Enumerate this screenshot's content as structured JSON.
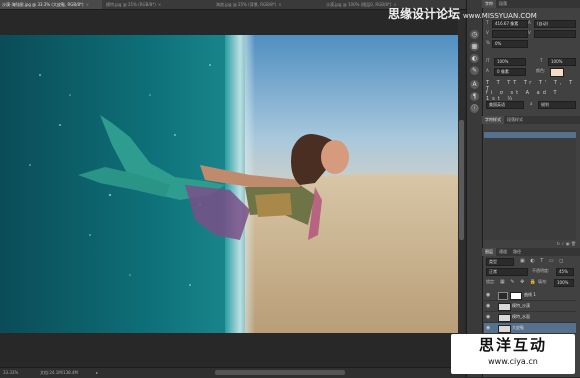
{
  "tabs": [
    {
      "label": "沙漠-海陆图.jpg @ 33.3% (大皮鞋, RGB/8*)",
      "active": true
    },
    {
      "label": "模特.jpg @ 25% (RGB/8*)",
      "active": false
    },
    {
      "label": "海浪.jpg @ 25% (背景, RGB/8*)",
      "active": false
    },
    {
      "label": "沙漠.jpg @ 100% (图层0, RGB/8*)",
      "active": false
    }
  ],
  "watermark_top": {
    "title": "思缘设计论坛",
    "site": "www.MISSYUAN.COM"
  },
  "watermark_bottom": {
    "title": "思洋互动",
    "url": "www.ciya.cn"
  },
  "status": {
    "zoom": "33.33%",
    "doc": "文档:24.1M/138.4M"
  },
  "character_panel": {
    "tabs": [
      "字符",
      "段落"
    ],
    "font_size": "416.67 像素",
    "leading": "(自动)",
    "tracking": "0%",
    "scale_v": "100%",
    "scale_h": "100%",
    "baseline": "0 像素",
    "color_label": "颜色:",
    "aa_label": "a",
    "aa_value": "锐利",
    "lang": "美国英语"
  },
  "paragraph_panel": {
    "tabs": [
      "字符样式",
      "段落样式"
    ]
  },
  "layers_panel": {
    "tabs": [
      "图层",
      "通道",
      "路径"
    ],
    "filter": "类型",
    "blend_mode": "正常",
    "opacity_label": "不透明度:",
    "opacity": "45%",
    "lock_label": "锁定:",
    "fill_label": "填充:",
    "fill": "100%",
    "layers": [
      {
        "name": "曲线 1",
        "selected": false
      },
      {
        "name": "模特_沙漠",
        "selected": false
      },
      {
        "name": "模特_水面",
        "selected": false
      },
      {
        "name": "大皮鞋",
        "selected": true
      }
    ]
  },
  "icons": [
    "close-icon",
    "eye-icon",
    "lock-icon",
    "search-icon",
    "adjustment-icon"
  ]
}
